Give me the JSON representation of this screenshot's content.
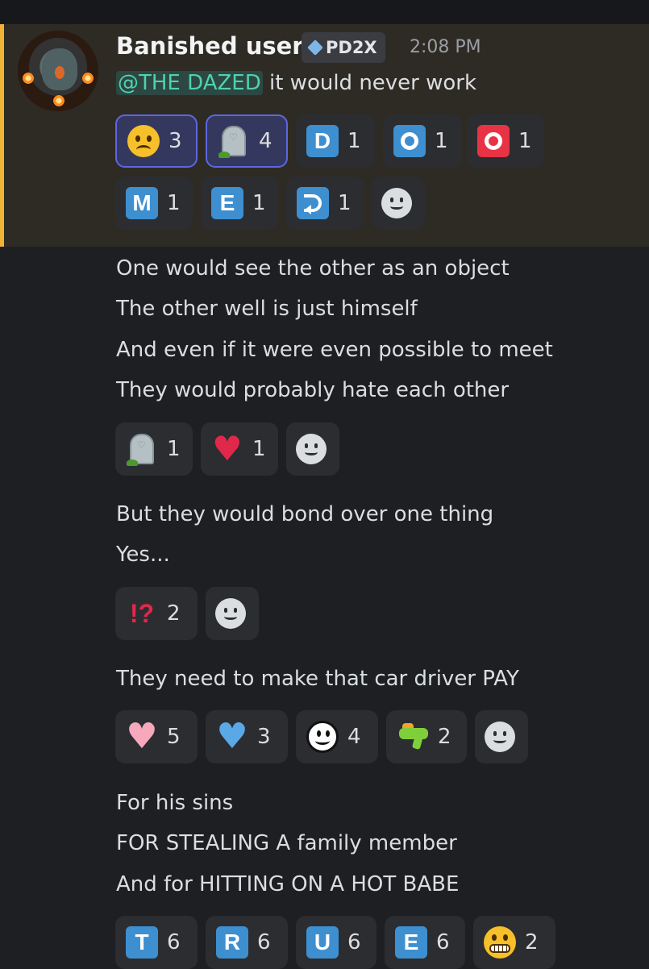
{
  "message": {
    "username": "Banished user",
    "tag": "PD2X",
    "timestamp": "2:08 PM",
    "mention": "@THE DAZED",
    "first_text": " it would never work",
    "first_reactions": [
      {
        "emoji": "sad-face",
        "count": "3",
        "me": true
      },
      {
        "emoji": "headstone",
        "count": "4",
        "me": true
      },
      {
        "emoji": "letter-d",
        "letter": "D",
        "count": "1"
      },
      {
        "emoji": "letter-o",
        "letter": "O",
        "count": "1"
      },
      {
        "emoji": "red-o",
        "letter": "O",
        "count": "1"
      },
      {
        "emoji": "letter-m",
        "letter": "M",
        "count": "1"
      },
      {
        "emoji": "letter-e",
        "letter": "E",
        "count": "1"
      },
      {
        "emoji": "return-arrow",
        "count": "1"
      }
    ]
  },
  "lines": {
    "l1": "One would see the other as an object",
    "l2": "The other well is just himself",
    "l3": "And even if it were even possible to meet",
    "l4": "They would probably hate each other",
    "l5": "But they would bond over one thing",
    "l6": "Yes...",
    "l7": "They need to make that car driver PAY",
    "l8": "For his sins",
    "l9": "FOR STEALING A family member",
    "l10": "And for HITTING ON A HOT BABE"
  },
  "reactions": {
    "group2": [
      {
        "emoji": "headstone",
        "count": "1"
      },
      {
        "emoji": "broken-heart",
        "count": "1"
      }
    ],
    "group3": [
      {
        "emoji": "interrobang",
        "count": "2"
      }
    ],
    "group4": [
      {
        "emoji": "pink-heart",
        "count": "5"
      },
      {
        "emoji": "blue-heart",
        "count": "3"
      },
      {
        "emoji": "smiley-face",
        "count": "4"
      },
      {
        "emoji": "water-pistol",
        "count": "2"
      }
    ],
    "group5": [
      {
        "emoji": "letter-t",
        "letter": "T",
        "count": "6"
      },
      {
        "emoji": "letter-r",
        "letter": "R",
        "count": "6"
      },
      {
        "emoji": "letter-u",
        "letter": "U",
        "count": "6"
      },
      {
        "emoji": "letter-e",
        "letter": "E",
        "count": "6"
      },
      {
        "emoji": "grimacing-face",
        "count": "2"
      }
    ]
  },
  "colors": {
    "background": "#1e1f23",
    "highlight": "#2e2b24",
    "highlight_bar": "#f0b232",
    "mention": "#4fd1b0",
    "letter_blue": "#3e8fd0",
    "letter_red": "#e83345"
  }
}
